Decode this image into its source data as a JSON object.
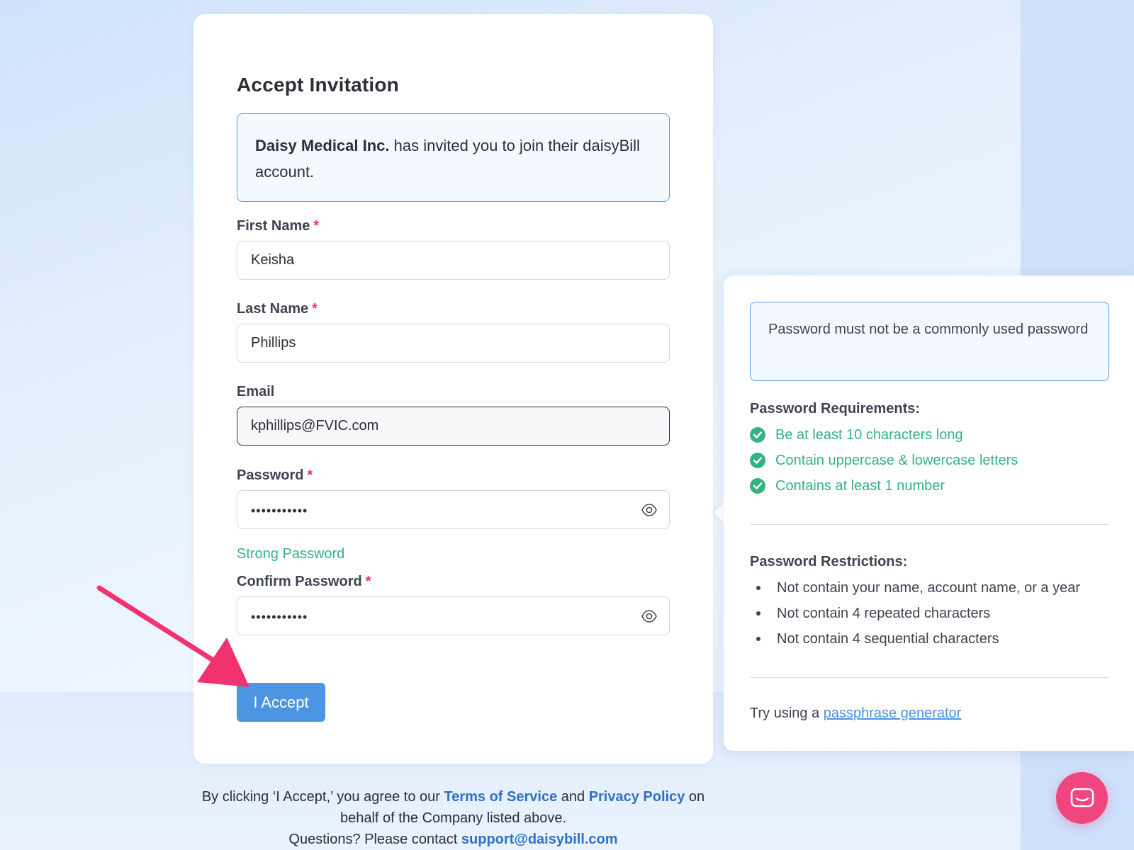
{
  "card": {
    "title": "Accept Invitation",
    "invite_company": "Daisy Medical Inc.",
    "invite_text": " has invited you to join their daisyBill account."
  },
  "form": {
    "first_name": {
      "label": "First Name",
      "required_mark": "*",
      "value": "Keisha"
    },
    "last_name": {
      "label": "Last Name",
      "required_mark": "*",
      "value": "Phillips"
    },
    "email": {
      "label": "Email",
      "value": "kphillips@FVIC.com"
    },
    "password": {
      "label": "Password",
      "required_mark": "*",
      "value": "•••••••••••",
      "strength": "Strong Password"
    },
    "confirm_password": {
      "label": "Confirm Password",
      "required_mark": "*",
      "value": "•••••••••••"
    },
    "accept_button": "I Accept"
  },
  "footer": {
    "line1_prefix": "By clicking ‘I Accept,’ you agree to our ",
    "terms_link": "Terms of Service",
    "and": " and ",
    "privacy_link": "Privacy Policy",
    "line1_suffix": " on behalf of the Company listed above.",
    "contact_prefix": "Questions? Please contact ",
    "support_email": "support@daisybill.com"
  },
  "popover": {
    "warning": "Password must not be a commonly used password",
    "requirements_heading": "Password Requirements:",
    "requirements": [
      "Be at least 10 characters long",
      "Contain uppercase & lowercase letters",
      "Contains at least 1 number"
    ],
    "restrictions_heading": "Password Restrictions:",
    "restrictions": [
      "Not contain your name, account name, or a year",
      "Not contain 4 repeated characters",
      "Not contain 4 sequential characters"
    ],
    "try_prefix": "Try using a ",
    "generator_link": "passphrase generator"
  },
  "colors": {
    "accent": "#4b95e3",
    "success": "#35b281",
    "required": "#e2396a",
    "annotation_arrow": "#f0336f",
    "chat_bubble": "#f0457f"
  },
  "icons": [
    "eye-icon",
    "check-circle-icon",
    "chat-icon",
    "annotation-arrow"
  ]
}
